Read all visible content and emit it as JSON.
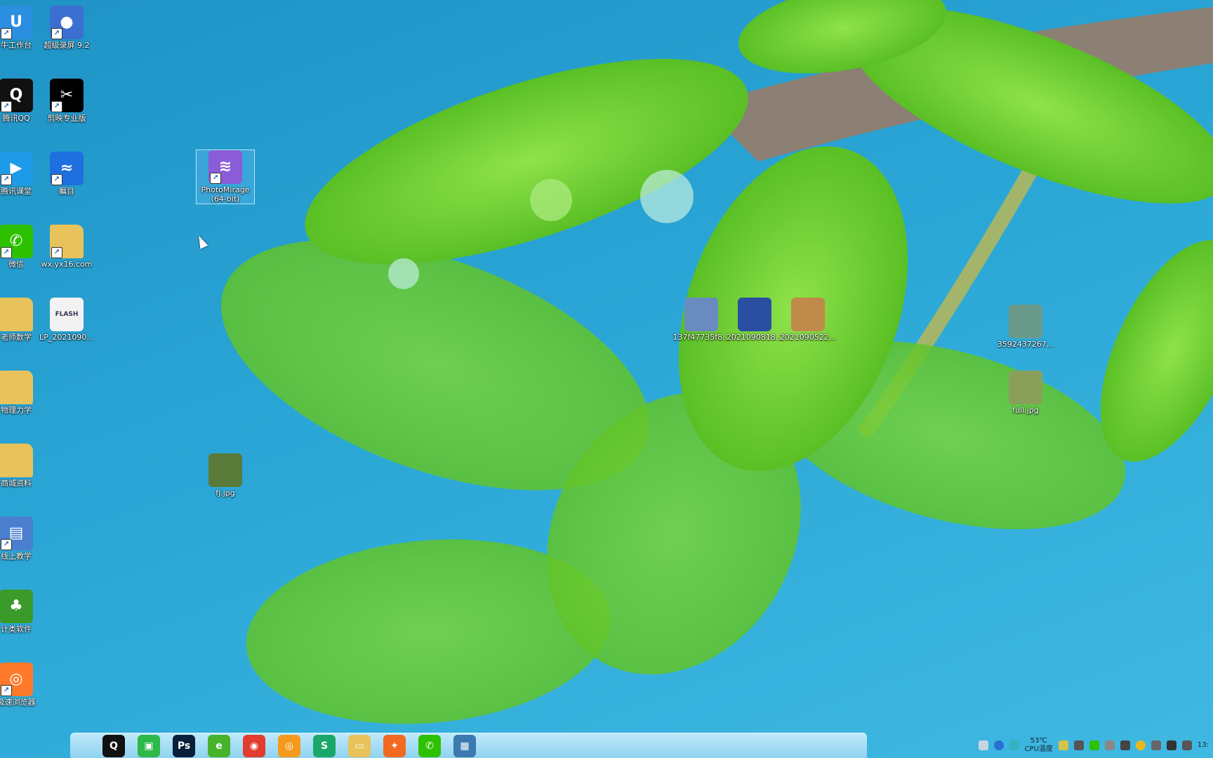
{
  "colors": {
    "sky": "#2aa6d6",
    "leaf": "#6fd02a",
    "leaf_dark": "#3f9e16",
    "branch": "#8a7d72"
  },
  "desktop": {
    "icons": [
      {
        "label": "牛工作台",
        "icon": "workbench-icon",
        "color": "#2a8fe0",
        "glyph": "U"
      },
      {
        "label": "超级录屏 9.2",
        "icon": "screen-recorder-icon",
        "color": "#3b6fd1",
        "glyph": "●"
      },
      {
        "label": "腾讯QQ",
        "icon": "qq-penguin-icon",
        "color": "#111",
        "glyph": "Q"
      },
      {
        "label": "剪映专业版",
        "icon": "jianying-icon",
        "color": "#000",
        "glyph": "✂"
      },
      {
        "label": "腾讯课堂",
        "icon": "tencent-classroom-icon",
        "color": "#1e9be8",
        "glyph": "▶"
      },
      {
        "label": "瞩目",
        "icon": "zhumu-icon",
        "color": "#1e6fe0",
        "glyph": "≈"
      },
      {
        "label": "微信",
        "icon": "wechat-icon",
        "color": "#2dc100",
        "glyph": "✆"
      },
      {
        "label": "wx.yx16.com",
        "icon": "folder-icon",
        "color": "#e8c25a",
        "glyph": ""
      },
      {
        "label": "老师数学",
        "icon": "folder-icon",
        "color": "#e8c25a",
        "glyph": ""
      },
      {
        "label": "LP_2021090...",
        "icon": "flash-file-icon",
        "color": "#f2f2f2",
        "glyph": "FLASH"
      },
      {
        "label": "物理力学",
        "icon": "folder-icon",
        "color": "#e8c25a",
        "glyph": ""
      },
      {
        "label": "商城资料",
        "icon": "folder-icon",
        "color": "#e8c25a",
        "glyph": ""
      },
      {
        "label": "线上教学",
        "icon": "network-computers-icon",
        "color": "#4a7fd0",
        "glyph": "▤"
      },
      {
        "label": "计类软件",
        "icon": "tree-icon",
        "color": "#3a9a2a",
        "glyph": "♣"
      },
      {
        "label": "极速浏览器",
        "icon": "browser-icon",
        "color": "#ff7a2a",
        "glyph": "◎"
      },
      {
        "label": "PhotoMirage (64-bit)",
        "icon": "photomirage-icon",
        "color": "#8a5cd8",
        "glyph": "≋"
      },
      {
        "label": "fj.jpg",
        "icon": "image-file-icon",
        "color": "#5a7a3a",
        "glyph": ""
      },
      {
        "label": "137f47735f8...",
        "icon": "video-file-icon",
        "color": "#6a8bc0",
        "glyph": ""
      },
      {
        "label": "2021090818...",
        "icon": "video-file-icon",
        "color": "#2a4fa0",
        "glyph": ""
      },
      {
        "label": "2021090522...",
        "icon": "video-file-icon",
        "color": "#c08a4a",
        "glyph": ""
      },
      {
        "label": "3592437267...",
        "icon": "image-file-icon",
        "color": "#6a9a8a",
        "glyph": ""
      },
      {
        "label": "full.jpg",
        "icon": "image-file-icon",
        "color": "#8aa05a",
        "glyph": ""
      }
    ]
  },
  "taskbar": {
    "apps": [
      {
        "name": "qq-taskbar-icon",
        "color": "#111",
        "glyph": "Q"
      },
      {
        "name": "screenshot-taskbar-icon",
        "color": "#2db84a",
        "glyph": "▣"
      },
      {
        "name": "photoshop-taskbar-icon",
        "color": "#0a1f3a",
        "glyph": "Ps"
      },
      {
        "name": "browser-green-taskbar-icon",
        "color": "#46b32b",
        "glyph": "e"
      },
      {
        "name": "chrome-taskbar-icon",
        "color": "#e33b2e",
        "glyph": "◉"
      },
      {
        "name": "speed-browser-taskbar-icon",
        "color": "#f59a1c",
        "glyph": "◎"
      },
      {
        "name": "wps-taskbar-icon",
        "color": "#1aa86a",
        "glyph": "S"
      },
      {
        "name": "file-explorer-taskbar-icon",
        "color": "#e8c25a",
        "glyph": "▭"
      },
      {
        "name": "firefox-taskbar-icon",
        "color": "#f26a22",
        "glyph": "✦"
      },
      {
        "name": "wechat-taskbar-icon",
        "color": "#2dc100",
        "glyph": "✆"
      },
      {
        "name": "photo-viewer-taskbar-icon",
        "color": "#3a7ab0",
        "glyph": "▦"
      }
    ]
  },
  "tray": {
    "cpu_temp": "53℃",
    "cpu_label": "CPU温度",
    "time": "13:"
  }
}
